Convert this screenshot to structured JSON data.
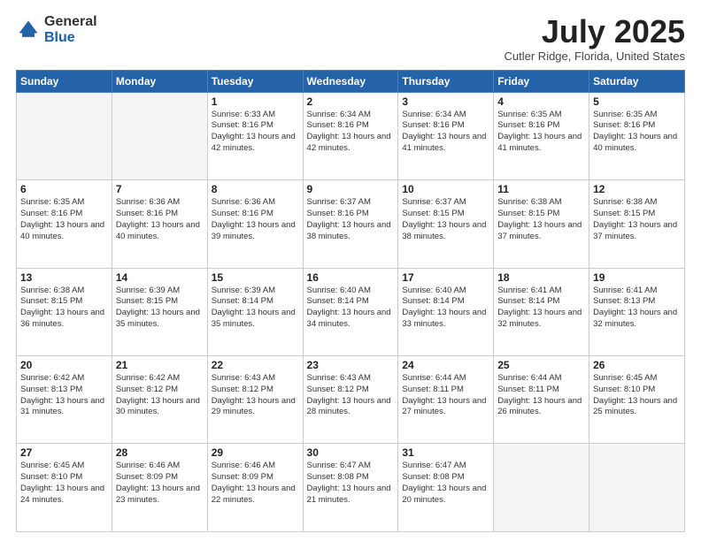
{
  "logo": {
    "general": "General",
    "blue": "Blue"
  },
  "title": "July 2025",
  "location": "Cutler Ridge, Florida, United States",
  "days_of_week": [
    "Sunday",
    "Monday",
    "Tuesday",
    "Wednesday",
    "Thursday",
    "Friday",
    "Saturday"
  ],
  "weeks": [
    [
      {
        "day": "",
        "info": "",
        "empty": true
      },
      {
        "day": "",
        "info": "",
        "empty": true
      },
      {
        "day": "1",
        "info": "Sunrise: 6:33 AM\nSunset: 8:16 PM\nDaylight: 13 hours and 42 minutes."
      },
      {
        "day": "2",
        "info": "Sunrise: 6:34 AM\nSunset: 8:16 PM\nDaylight: 13 hours and 42 minutes."
      },
      {
        "day": "3",
        "info": "Sunrise: 6:34 AM\nSunset: 8:16 PM\nDaylight: 13 hours and 41 minutes."
      },
      {
        "day": "4",
        "info": "Sunrise: 6:35 AM\nSunset: 8:16 PM\nDaylight: 13 hours and 41 minutes."
      },
      {
        "day": "5",
        "info": "Sunrise: 6:35 AM\nSunset: 8:16 PM\nDaylight: 13 hours and 40 minutes."
      }
    ],
    [
      {
        "day": "6",
        "info": "Sunrise: 6:35 AM\nSunset: 8:16 PM\nDaylight: 13 hours and 40 minutes."
      },
      {
        "day": "7",
        "info": "Sunrise: 6:36 AM\nSunset: 8:16 PM\nDaylight: 13 hours and 40 minutes."
      },
      {
        "day": "8",
        "info": "Sunrise: 6:36 AM\nSunset: 8:16 PM\nDaylight: 13 hours and 39 minutes."
      },
      {
        "day": "9",
        "info": "Sunrise: 6:37 AM\nSunset: 8:16 PM\nDaylight: 13 hours and 38 minutes."
      },
      {
        "day": "10",
        "info": "Sunrise: 6:37 AM\nSunset: 8:15 PM\nDaylight: 13 hours and 38 minutes."
      },
      {
        "day": "11",
        "info": "Sunrise: 6:38 AM\nSunset: 8:15 PM\nDaylight: 13 hours and 37 minutes."
      },
      {
        "day": "12",
        "info": "Sunrise: 6:38 AM\nSunset: 8:15 PM\nDaylight: 13 hours and 37 minutes."
      }
    ],
    [
      {
        "day": "13",
        "info": "Sunrise: 6:38 AM\nSunset: 8:15 PM\nDaylight: 13 hours and 36 minutes."
      },
      {
        "day": "14",
        "info": "Sunrise: 6:39 AM\nSunset: 8:15 PM\nDaylight: 13 hours and 35 minutes."
      },
      {
        "day": "15",
        "info": "Sunrise: 6:39 AM\nSunset: 8:14 PM\nDaylight: 13 hours and 35 minutes."
      },
      {
        "day": "16",
        "info": "Sunrise: 6:40 AM\nSunset: 8:14 PM\nDaylight: 13 hours and 34 minutes."
      },
      {
        "day": "17",
        "info": "Sunrise: 6:40 AM\nSunset: 8:14 PM\nDaylight: 13 hours and 33 minutes."
      },
      {
        "day": "18",
        "info": "Sunrise: 6:41 AM\nSunset: 8:14 PM\nDaylight: 13 hours and 32 minutes."
      },
      {
        "day": "19",
        "info": "Sunrise: 6:41 AM\nSunset: 8:13 PM\nDaylight: 13 hours and 32 minutes."
      }
    ],
    [
      {
        "day": "20",
        "info": "Sunrise: 6:42 AM\nSunset: 8:13 PM\nDaylight: 13 hours and 31 minutes."
      },
      {
        "day": "21",
        "info": "Sunrise: 6:42 AM\nSunset: 8:12 PM\nDaylight: 13 hours and 30 minutes."
      },
      {
        "day": "22",
        "info": "Sunrise: 6:43 AM\nSunset: 8:12 PM\nDaylight: 13 hours and 29 minutes."
      },
      {
        "day": "23",
        "info": "Sunrise: 6:43 AM\nSunset: 8:12 PM\nDaylight: 13 hours and 28 minutes."
      },
      {
        "day": "24",
        "info": "Sunrise: 6:44 AM\nSunset: 8:11 PM\nDaylight: 13 hours and 27 minutes."
      },
      {
        "day": "25",
        "info": "Sunrise: 6:44 AM\nSunset: 8:11 PM\nDaylight: 13 hours and 26 minutes."
      },
      {
        "day": "26",
        "info": "Sunrise: 6:45 AM\nSunset: 8:10 PM\nDaylight: 13 hours and 25 minutes."
      }
    ],
    [
      {
        "day": "27",
        "info": "Sunrise: 6:45 AM\nSunset: 8:10 PM\nDaylight: 13 hours and 24 minutes."
      },
      {
        "day": "28",
        "info": "Sunrise: 6:46 AM\nSunset: 8:09 PM\nDaylight: 13 hours and 23 minutes."
      },
      {
        "day": "29",
        "info": "Sunrise: 6:46 AM\nSunset: 8:09 PM\nDaylight: 13 hours and 22 minutes."
      },
      {
        "day": "30",
        "info": "Sunrise: 6:47 AM\nSunset: 8:08 PM\nDaylight: 13 hours and 21 minutes."
      },
      {
        "day": "31",
        "info": "Sunrise: 6:47 AM\nSunset: 8:08 PM\nDaylight: 13 hours and 20 minutes."
      },
      {
        "day": "",
        "info": "",
        "empty": true
      },
      {
        "day": "",
        "info": "",
        "empty": true
      }
    ]
  ]
}
